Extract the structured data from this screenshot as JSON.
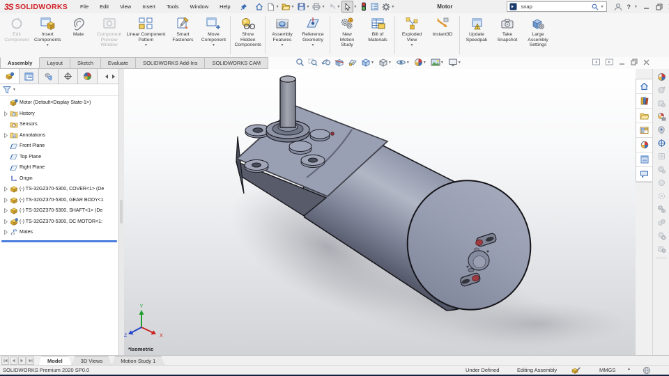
{
  "colors": {
    "brand_red": "#d2232a",
    "accent_blue": "#3a6db5",
    "part_yellow": "#e8b33a",
    "model_gray": "#9096aa",
    "rollback_blue": "#4a7dde"
  },
  "titlebar": {
    "logo_mark": "3S",
    "logo_text": "SOLIDWORKS",
    "menus": [
      "File",
      "Edit",
      "View",
      "Insert",
      "Tools",
      "Window",
      "Help"
    ],
    "document_title": "Motor",
    "search_value": "snap",
    "help_label": "?"
  },
  "ribbon": {
    "buttons": [
      {
        "label": "Edit\nComponent",
        "enabled": false,
        "dropdown": false
      },
      {
        "label": "Insert\nComponents",
        "enabled": true,
        "dropdown": true
      },
      {
        "label": "Mate",
        "enabled": true,
        "dropdown": false
      },
      {
        "label": "Component\nPreview\nWindow",
        "enabled": false,
        "dropdown": false
      },
      {
        "label": "Linear Component\nPattern",
        "enabled": true,
        "dropdown": true
      },
      {
        "label": "Smart\nFasteners",
        "enabled": true,
        "dropdown": false
      },
      {
        "label": "Move\nComponent",
        "enabled": true,
        "dropdown": true
      },
      {
        "label": "Show\nHidden\nComponents",
        "enabled": true,
        "dropdown": false
      },
      {
        "label": "Assembly\nFeatures",
        "enabled": true,
        "dropdown": true
      },
      {
        "label": "Reference\nGeometry",
        "enabled": true,
        "dropdown": true
      },
      {
        "label": "New\nMotion\nStudy",
        "enabled": true,
        "dropdown": false
      },
      {
        "label": "Bill of\nMaterials",
        "enabled": true,
        "dropdown": false
      },
      {
        "label": "Exploded\nView",
        "enabled": true,
        "dropdown": true
      },
      {
        "label": "Instant3D",
        "enabled": true,
        "dropdown": false
      },
      {
        "label": "Update\nSpeedpak",
        "enabled": true,
        "dropdown": false
      },
      {
        "label": "Take\nSnapshot",
        "enabled": true,
        "dropdown": false
      },
      {
        "label": "Large\nAssembly\nSettings",
        "enabled": true,
        "dropdown": false
      }
    ]
  },
  "command_tabs": {
    "items": [
      "Assembly",
      "Layout",
      "Sketch",
      "Evaluate",
      "SOLIDWORKS Add-Ins",
      "SOLIDWORKS CAM"
    ],
    "active": "Assembly"
  },
  "feature_tree": {
    "items": [
      {
        "label": "Motor (Default<Display State-1>)",
        "icon": "assembly",
        "expandable": false
      },
      {
        "label": "History",
        "icon": "history-folder",
        "expandable": true
      },
      {
        "label": "Sensors",
        "icon": "sensors-folder",
        "expandable": false
      },
      {
        "label": "Annotations",
        "icon": "annotations-folder",
        "expandable": true
      },
      {
        "label": "Front Plane",
        "icon": "plane",
        "expandable": false
      },
      {
        "label": "Top Plane",
        "icon": "plane",
        "expandable": false
      },
      {
        "label": "Right Plane",
        "icon": "plane",
        "expandable": false
      },
      {
        "label": "Origin",
        "icon": "origin",
        "expandable": false
      },
      {
        "label": "(-) TS-32GZ370-5300, COVER<1> (De",
        "icon": "part",
        "expandable": true
      },
      {
        "label": "(-) TS-32GZ370-5300, GEAR BODY<1",
        "icon": "part",
        "expandable": true
      },
      {
        "label": "(-) TS-32GZ370-5300, SHAFT<1> (De",
        "icon": "part",
        "expandable": true
      },
      {
        "label": "(-) TS-32GZ370-5300, DC MOTOR<1:",
        "icon": "part-motor",
        "expandable": true
      },
      {
        "label": "Mates",
        "icon": "mates",
        "expandable": true
      }
    ]
  },
  "viewport": {
    "view_label": "*Isometric",
    "triad": {
      "x": "X",
      "y": "Y",
      "z": "Z"
    }
  },
  "bottom_tabs": {
    "items": [
      "Model",
      "3D Views",
      "Motion Study 1"
    ],
    "active": "Model"
  },
  "statusbar": {
    "left": "SOLIDWORKS Premium 2020 SP0.0",
    "state": "Under Defined",
    "mode": "Editing Assembly",
    "units": "MMGS"
  }
}
